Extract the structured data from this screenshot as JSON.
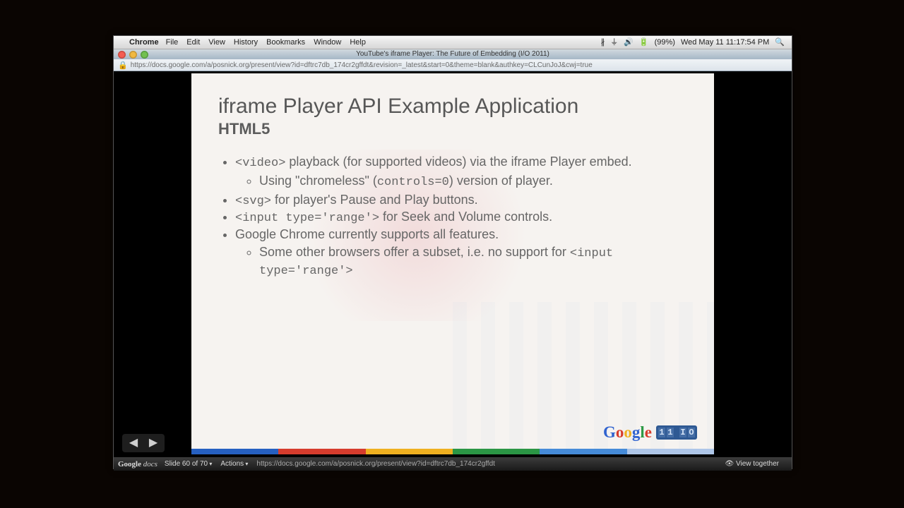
{
  "mac_menu": {
    "app": "Chrome",
    "items": [
      "File",
      "Edit",
      "View",
      "History",
      "Bookmarks",
      "Window",
      "Help"
    ],
    "battery": "(99%)",
    "datetime": "Wed May 11  11:17:54 PM"
  },
  "chrome": {
    "tab_title": "YouTube's iframe Player: The Future of Embedding (I/O 2011)",
    "url": "https://docs.google.com/a/posnick.org/present/view?id=dftrc7db_174cr2gffdt&revision=_latest&start=0&theme=blank&authkey=CLCunJoJ&cwj=true"
  },
  "slide": {
    "title": "iframe Player API Example Application",
    "subtitle": "HTML5",
    "b1_code": "<video>",
    "b1_text": " playback (for supported videos) via the iframe Player embed.",
    "b1a_pre": "Using \"chromeless\" (",
    "b1a_code": "controls=0",
    "b1a_post": ") version of player.",
    "b2_code": "<svg>",
    "b2_text": " for player's Pause and Play buttons.",
    "b3_code": "<input type='range'>",
    "b3_text": " for Seek and Volume controls.",
    "b4_text": "Google Chrome currently supports all features.",
    "b4a_pre": "Some other browsers offer a subset, i.e. no support for ",
    "b4a_code": "<input type='range'>",
    "logo_prefix": "Google",
    "io": "I/O"
  },
  "footer": {
    "product": "Google docs",
    "slide_indicator": "Slide 60 of 70",
    "actions": "Actions",
    "status_url": "https://docs.google.com/a/posnick.org/present/view?id=dftrc7db_174cr2gffdt",
    "view_together": "View together"
  }
}
